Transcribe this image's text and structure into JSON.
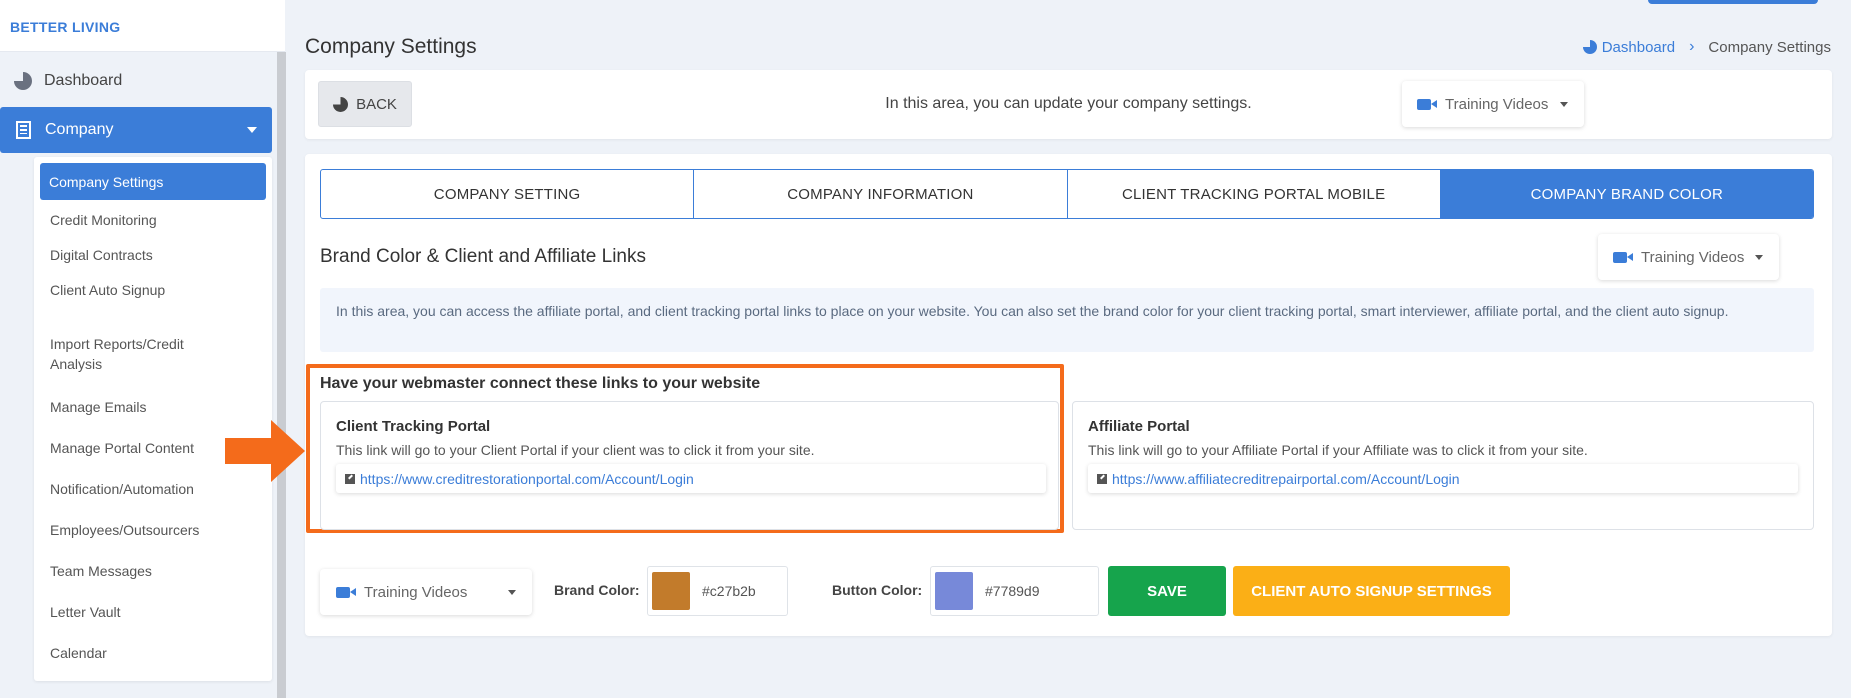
{
  "sidebar": {
    "brand": "BETTER LIVING",
    "dashboard": "Dashboard",
    "company": "Company",
    "submenu": [
      "Company Settings",
      "Credit Monitoring",
      "Digital Contracts",
      "Client Auto Signup",
      "Import Reports/Credit Analysis",
      "Manage Emails",
      "Manage Portal Content",
      "Notification/Automation",
      "Employees/Outsourcers",
      "Team Messages",
      "Letter Vault",
      "Calendar"
    ]
  },
  "header": {
    "title": "Company Settings",
    "breadcrumb_home": "Dashboard",
    "breadcrumb_current": "Company Settings"
  },
  "topbar": {
    "back_label": "BACK",
    "message": "In this area, you can update your company settings.",
    "training_label": "Training Videos"
  },
  "tabs": [
    "COMPANY SETTING",
    "COMPANY INFORMATION",
    "CLIENT TRACKING PORTAL MOBILE",
    "COMPANY BRAND COLOR"
  ],
  "section": {
    "title": "Brand Color & Client and Affiliate Links",
    "training_label": "Training Videos",
    "info": "In this area, you can access the affiliate portal, and client tracking portal links to place on your website. You can also set the brand color for your client tracking portal, smart interviewer, affiliate portal, and the client auto signup.",
    "links_heading": "Have your webmaster connect these links to your website"
  },
  "cards": [
    {
      "title": "Client Tracking Portal",
      "desc": "This link will go to your Client Portal if your client was to click it from your site.",
      "url": "https://www.creditrestorationportal.com/Account/Login"
    },
    {
      "title": "Affiliate Portal",
      "desc": "This link will go to your Affiliate Portal if your Affiliate was to click it from your site.",
      "url": "https://www.affiliatecreditrepairportal.com/Account/Login"
    }
  ],
  "bottom": {
    "training_label": "Training Videos",
    "brand_color_label": "Brand Color:",
    "brand_color_value": "#c27b2b",
    "button_color_label": "Button Color:",
    "button_color_value": "#7789d9",
    "save_label": "SAVE",
    "signup_label": "CLIENT AUTO SIGNUP SETTINGS"
  },
  "colors": {
    "primary": "#3b7dd8",
    "highlight": "#f46b1b",
    "save": "#16a44c",
    "signup": "#fbaf16"
  }
}
